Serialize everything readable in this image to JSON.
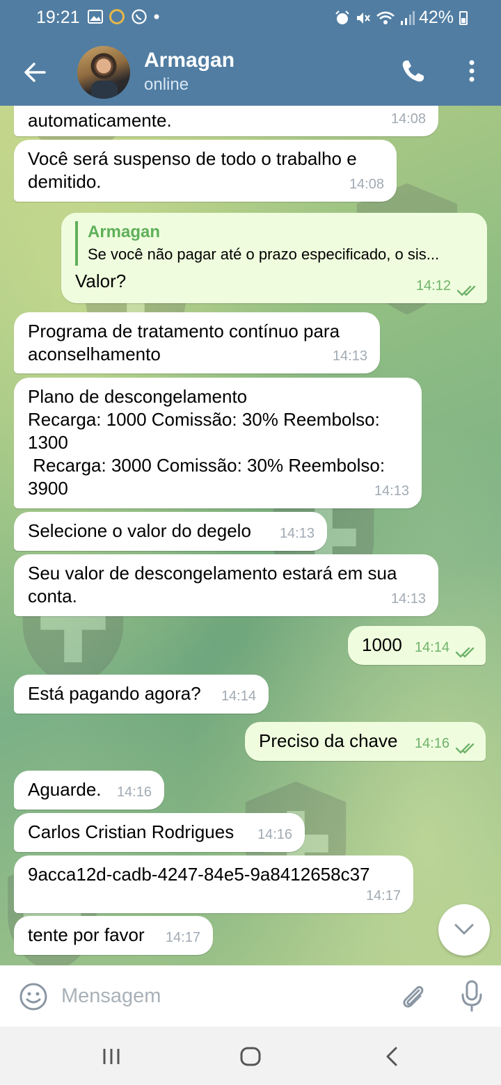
{
  "status_bar": {
    "time": "19:21",
    "battery": "42%"
  },
  "header": {
    "contact_name": "Armagan",
    "contact_status": "online"
  },
  "messages": [
    {
      "dir": "in",
      "text": "automaticamente.",
      "time": "14:08"
    },
    {
      "dir": "in",
      "text": "Você será suspenso de todo o trabalho e\ndemitido.",
      "time": "14:08"
    },
    {
      "dir": "out",
      "reply_name": "Armagan",
      "reply_text": "Se você não pagar até o prazo especificado, o sis...",
      "text": "Valor?",
      "time": "14:12"
    },
    {
      "dir": "in",
      "text": "Programa de tratamento contínuo para\naconselhamento",
      "time": "14:13"
    },
    {
      "dir": "in",
      "text": "Plano de descongelamento\nRecarga: 1000 Comissão: 30% Reembolso:\n1300\n Recarga: 3000 Comissão: 30% Reembolso:\n3900",
      "time": "14:13"
    },
    {
      "dir": "in",
      "text": "Selecione o valor do degelo",
      "time": "14:13"
    },
    {
      "dir": "in",
      "text": "Seu valor de descongelamento estará em sua\nconta.",
      "time": "14:13"
    },
    {
      "dir": "out",
      "text": "1000",
      "time": "14:14"
    },
    {
      "dir": "in",
      "text": "Está pagando agora?",
      "time": "14:14"
    },
    {
      "dir": "out",
      "text": "Preciso da chave",
      "time": "14:16"
    },
    {
      "dir": "in",
      "text": "Aguarde.",
      "time": "14:16"
    },
    {
      "dir": "in",
      "text": "Carlos Cristian Rodrigues",
      "time": "14:16"
    },
    {
      "dir": "in",
      "text": "9acca12d-cadb-4247-84e5-9a8412658c37",
      "time": "14:17"
    },
    {
      "dir": "in",
      "text": "tente por favor",
      "time": "14:17"
    }
  ],
  "input": {
    "placeholder": "Mensagem"
  },
  "colors": {
    "header": "#517da2",
    "outgoing_bubble": "#effdde",
    "incoming_bubble": "#ffffff",
    "check_color": "#6fb26a"
  },
  "icons": {
    "back": "arrow-left-icon",
    "call": "phone-icon",
    "more": "more-vertical-icon",
    "emoji": "emoji-icon",
    "attach": "paperclip-icon",
    "mic": "microphone-icon",
    "scroll": "chevron-down-icon",
    "read": "double-check-icon"
  }
}
